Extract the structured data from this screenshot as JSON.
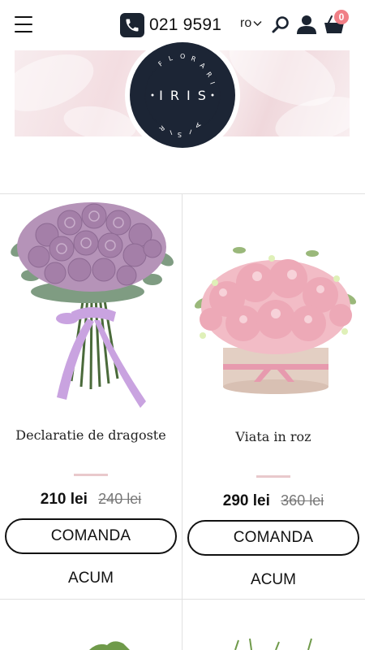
{
  "header": {
    "phone_number": "021 9591",
    "language": "ro",
    "cart_count": "0"
  },
  "logo": {
    "brand": "IRIS",
    "ring_text": "FLORARIA"
  },
  "products": [
    {
      "name": "Declaratie de dragoste",
      "price": "210 lei",
      "old_price": "240 lei",
      "button_label": "COMANDA",
      "button_label_2": "ACUM"
    },
    {
      "name": "Viata in roz",
      "price": "290 lei",
      "old_price": "360 lei",
      "button_label": "COMANDA",
      "button_label_2": "ACUM"
    }
  ],
  "colors": {
    "brand_navy": "#1c2535",
    "accent_pink": "#f07f86"
  }
}
